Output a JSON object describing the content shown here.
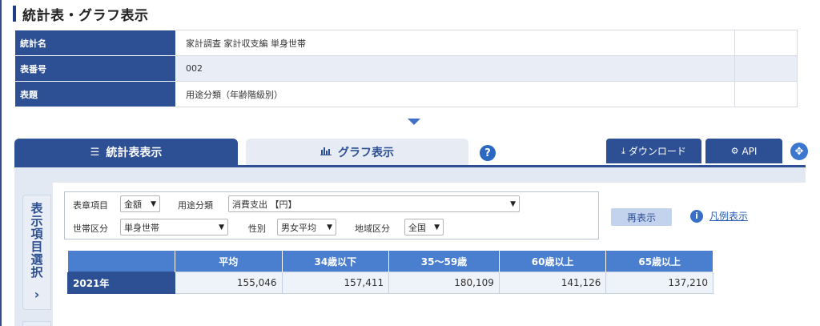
{
  "page_title": "統計表・グラフ表示",
  "meta": [
    {
      "key": "統計名",
      "value": "家計調査 家計収支編 単身世帯"
    },
    {
      "key": "表番号",
      "value": "002"
    },
    {
      "key": "表題",
      "value": "用途分類（年齢階級別）"
    }
  ],
  "tabs": {
    "table": "統計表表示",
    "graph": "グラフ表示"
  },
  "buttons": {
    "download": "ダウンロード",
    "api": "API",
    "redisplay": "再表示",
    "legend": "凡例表示"
  },
  "side_tab_label": "表示項目選択",
  "filters": {
    "hyosho_label": "表章項目",
    "hyosho_value": "金額",
    "yoto_label": "用途分類",
    "yoto_value": "消費支出 【円】",
    "setai_label": "世帯区分",
    "setai_value": "単身世帯",
    "seibetsu_label": "性別",
    "seibetsu_value": "男女平均",
    "chiiki_label": "地域区分",
    "chiiki_value": "全国"
  },
  "table": {
    "columns": [
      "平均",
      "34歳以下",
      "35～59歳",
      "60歳以上",
      "65歳以上"
    ],
    "rows": [
      {
        "label": "2021年",
        "values": [
          "155,046",
          "157,411",
          "180,109",
          "141,126",
          "137,210"
        ]
      }
    ]
  },
  "icons": [
    "list-icon",
    "bar-chart-icon",
    "help-icon",
    "download-icon",
    "gears-icon",
    "expand-icon",
    "info-icon",
    "chevron-right-icon",
    "chevron-down-icon"
  ]
}
